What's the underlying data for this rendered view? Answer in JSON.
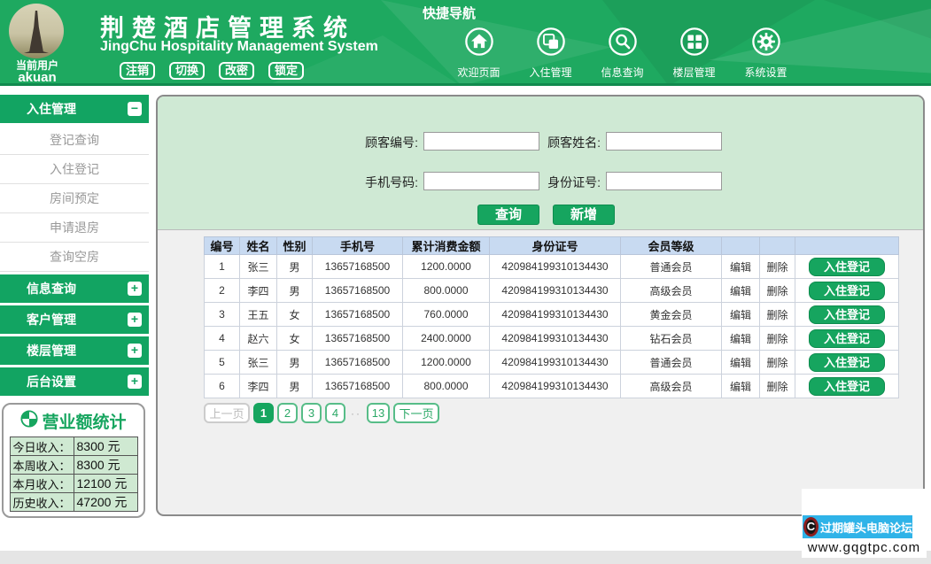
{
  "header": {
    "user": {
      "caption": "当前用户",
      "username": "akuan"
    },
    "title": "荆楚酒店管理系统",
    "subtitle": "JingChu Hospitality Management System",
    "user_buttons": [
      {
        "label": "注销"
      },
      {
        "label": "切换"
      },
      {
        "label": "改密"
      },
      {
        "label": "锁定"
      }
    ],
    "quick_nav_title": "快捷导航",
    "quick_nav": [
      {
        "label": "欢迎页面",
        "icon": "home-icon"
      },
      {
        "label": "入住管理",
        "icon": "checkin-windows-icon"
      },
      {
        "label": "信息查询",
        "icon": "search-icon"
      },
      {
        "label": "楼层管理",
        "icon": "floor-grid-icon"
      },
      {
        "label": "系统设置",
        "icon": "gear-icon"
      }
    ]
  },
  "sidebar": {
    "sections": [
      {
        "label": "入住管理",
        "expanded": true,
        "items": [
          "登记查询",
          "入住登记",
          "房间预定",
          "申请退房",
          "查询空房"
        ]
      },
      {
        "label": "信息查询",
        "expanded": false
      },
      {
        "label": "客户管理",
        "expanded": false
      },
      {
        "label": "楼层管理",
        "expanded": false
      },
      {
        "label": "后台设置",
        "expanded": false
      }
    ]
  },
  "stats": {
    "title": "营业额统计",
    "rows": [
      {
        "label": "今日收入：",
        "value": "8300 元"
      },
      {
        "label": "本周收入：",
        "value": "8300 元"
      },
      {
        "label": "本月收入：",
        "value": "12100 元"
      },
      {
        "label": "历史收入：",
        "value": "47200 元"
      }
    ]
  },
  "search_form": {
    "fields": [
      {
        "label": "顾客编号:",
        "value": ""
      },
      {
        "label": "顾客姓名:",
        "value": ""
      },
      {
        "label": "手机号码:",
        "value": ""
      },
      {
        "label": "身份证号:",
        "value": ""
      }
    ],
    "query_button": "查询",
    "add_button": "新增"
  },
  "table": {
    "headers": [
      "编号",
      "姓名",
      "性别",
      "手机号",
      "累计消费金额",
      "身份证号",
      "会员等级"
    ],
    "edit_label": "编辑",
    "delete_label": "删除",
    "checkin_label": "入住登记",
    "rows": [
      {
        "id": "1",
        "name": "张三",
        "gender": "男",
        "phone": "13657168500",
        "total": "1200.0000",
        "idcard": "420984199310134430",
        "level": "普通会员"
      },
      {
        "id": "2",
        "name": "李四",
        "gender": "男",
        "phone": "13657168500",
        "total": "800.0000",
        "idcard": "420984199310134430",
        "level": "高级会员"
      },
      {
        "id": "3",
        "name": "王五",
        "gender": "女",
        "phone": "13657168500",
        "total": "760.0000",
        "idcard": "420984199310134430",
        "level": "黄金会员"
      },
      {
        "id": "4",
        "name": "赵六",
        "gender": "女",
        "phone": "13657168500",
        "total": "2400.0000",
        "idcard": "420984199310134430",
        "level": "钻石会员"
      },
      {
        "id": "5",
        "name": "张三",
        "gender": "男",
        "phone": "13657168500",
        "total": "1200.0000",
        "idcard": "420984199310134430",
        "level": "普通会员"
      },
      {
        "id": "6",
        "name": "李四",
        "gender": "男",
        "phone": "13657168500",
        "total": "800.0000",
        "idcard": "420984199310134430",
        "level": "高级会员"
      }
    ]
  },
  "pagination": {
    "prev": "上一页",
    "pages": [
      "1",
      "2",
      "3",
      "4"
    ],
    "active_page": "1",
    "ellipsis": "··",
    "last_page": "13",
    "next": "下一页"
  },
  "watermark": {
    "line1": "过期罐头电脑论坛",
    "line2": "www.gqgtpc.com",
    "logo_letter": "C"
  },
  "colors": {
    "header_green": "#1ea960",
    "sidebar_green": "#12a462",
    "accent_green": "#16a55f",
    "form_bg_green": "#cfe9d4",
    "table_header_blue": "#c8daf1",
    "watermark_blue": "#2fb3e8",
    "footer_gray": "#e5e5e5"
  }
}
